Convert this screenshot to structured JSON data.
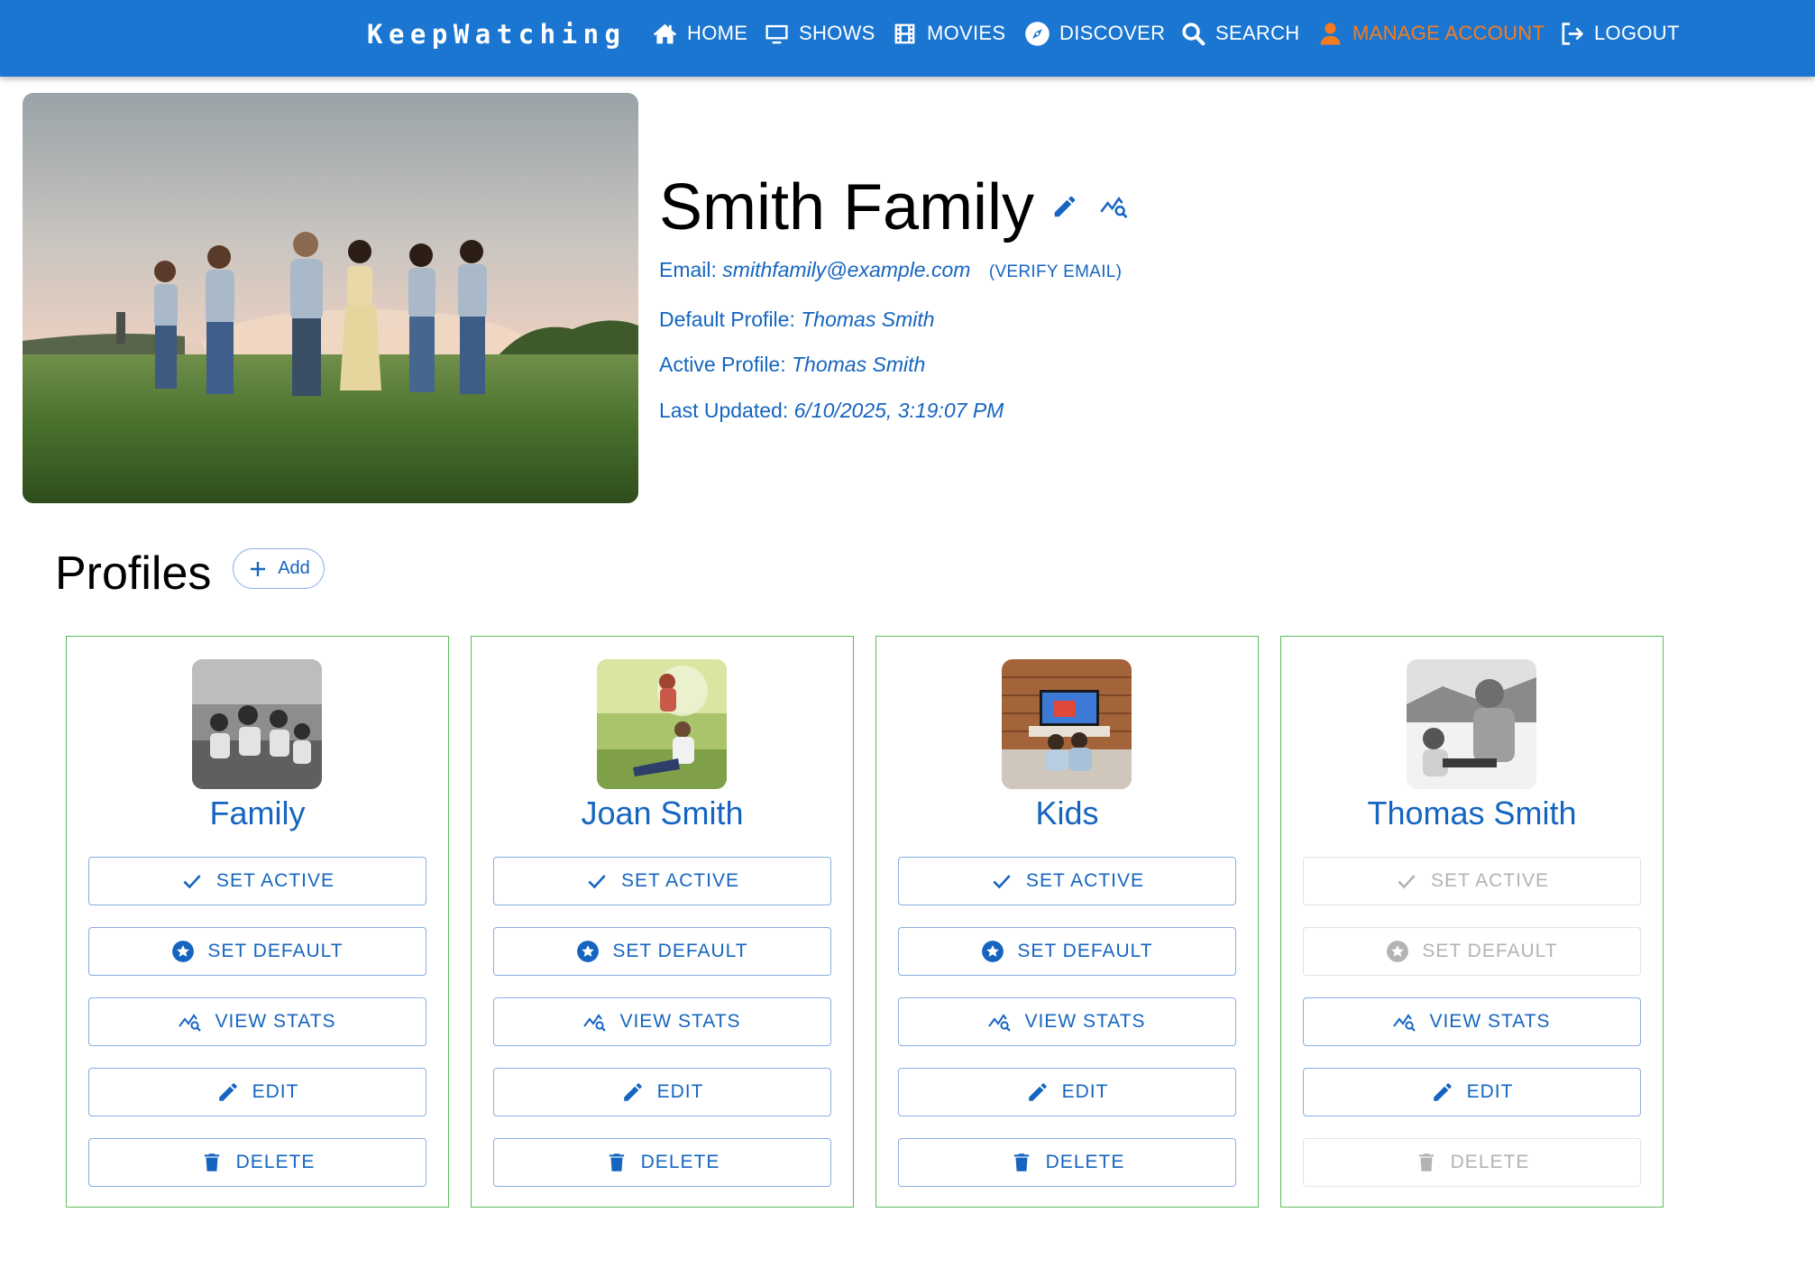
{
  "app": {
    "brand": "KeepWatching"
  },
  "nav": {
    "items": [
      {
        "label": "HOME",
        "icon": "home-icon"
      },
      {
        "label": "SHOWS",
        "icon": "tv-icon"
      },
      {
        "label": "MOVIES",
        "icon": "film-icon"
      },
      {
        "label": "DISCOVER",
        "icon": "compass-icon"
      },
      {
        "label": "SEARCH",
        "icon": "search-icon"
      },
      {
        "label": "MANAGE ACCOUNT",
        "icon": "person-icon",
        "active": true
      },
      {
        "label": "LOGOUT",
        "icon": "logout-icon"
      }
    ]
  },
  "account": {
    "name": "Smith Family",
    "email_label": "Email:",
    "email": "smithfamily@example.com",
    "verify_label": "(VERIFY EMAIL)",
    "default_profile_label": "Default Profile:",
    "default_profile": "Thomas Smith",
    "active_profile_label": "Active Profile:",
    "active_profile": "Thomas Smith",
    "last_updated_label": "Last Updated:",
    "last_updated": "6/10/2025, 3:19:07 PM"
  },
  "profiles": {
    "title": "Profiles",
    "add_label": "Add",
    "button_labels": {
      "set_active": "SET ACTIVE",
      "set_default": "SET DEFAULT",
      "view_stats": "VIEW STATS",
      "edit": "EDIT",
      "delete": "DELETE"
    },
    "items": [
      {
        "name": "Family",
        "is_active": false,
        "is_default": false
      },
      {
        "name": "Joan Smith",
        "is_active": false,
        "is_default": false
      },
      {
        "name": "Kids",
        "is_active": false,
        "is_default": false
      },
      {
        "name": "Thomas Smith",
        "is_active": true,
        "is_default": true
      }
    ]
  },
  "colors": {
    "navbar": "#1b76d2",
    "nav_active": "#f47c20",
    "link_blue": "#1565c0",
    "card_border": "#5cbc5c",
    "disabled": "#b3b3b3"
  }
}
